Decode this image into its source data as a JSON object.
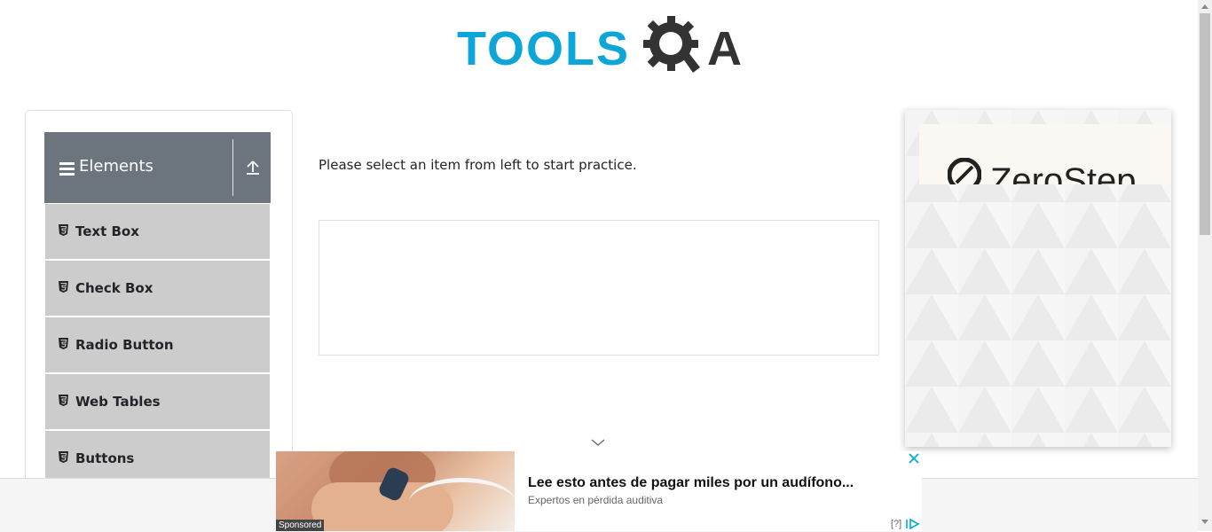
{
  "logo": {
    "text": "TOOLS",
    "suffix": "A"
  },
  "sidebar": {
    "group_title": "Elements",
    "items": [
      {
        "label": "Text Box"
      },
      {
        "label": "Check Box"
      },
      {
        "label": "Radio Button"
      },
      {
        "label": "Web Tables"
      },
      {
        "label": "Buttons"
      }
    ]
  },
  "main": {
    "instruction": "Please select an item from left to start practice."
  },
  "ad_right": {
    "brand": "ZeroStep"
  },
  "ad_bottom": {
    "title": "Lee esto antes de pagar miles por un audífono...",
    "subtitle": "Expertos en pérdida auditiva",
    "sponsored": "Sponsored",
    "help": "[?]"
  },
  "colors": {
    "brand_blue": "#0ea5d8",
    "header_gray": "#6c757d",
    "item_gray": "#cccccc"
  }
}
